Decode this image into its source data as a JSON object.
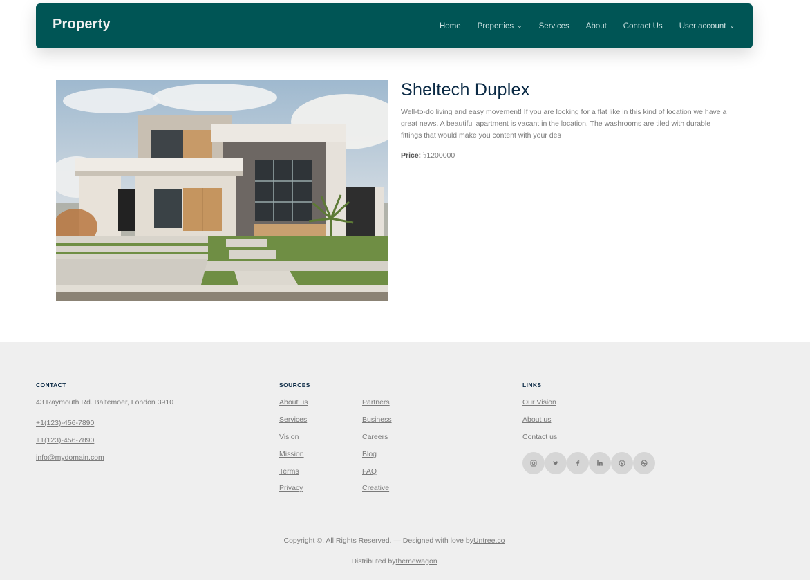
{
  "nav": {
    "brand": "Property",
    "items": [
      {
        "label": "Home",
        "dropdown": false
      },
      {
        "label": "Properties",
        "dropdown": true
      },
      {
        "label": "Services",
        "dropdown": false
      },
      {
        "label": "About",
        "dropdown": false
      },
      {
        "label": "Contact Us",
        "dropdown": false
      },
      {
        "label": "User account",
        "dropdown": true
      }
    ]
  },
  "property": {
    "title": "Sheltech Duplex",
    "description": "Well-to-do living and easy movement! If you are looking for a flat like in this kind of location we have a great news. A beautiful apartment is vacant in the location. The washrooms are tiled with durable fittings that would make you content with your des",
    "price_label": "Price:",
    "price_value": "৳1200000"
  },
  "footer": {
    "contact": {
      "heading": "CONTACT",
      "address": "43 Raymouth Rd. Baltemoer, London 3910",
      "phone1": "+1(123)-456-7890",
      "phone2": "+1(123)-456-7890",
      "email": "info@mydomain.com"
    },
    "sources": {
      "heading": "SOURCES",
      "col1": [
        "About us",
        "Services",
        "Vision",
        "Mission",
        "Terms",
        "Privacy"
      ],
      "col2": [
        "Partners",
        "Business",
        "Careers",
        "Blog",
        "FAQ",
        "Creative"
      ]
    },
    "links": {
      "heading": "LINKS",
      "items": [
        "Our Vision",
        "About us",
        "Contact us"
      ]
    },
    "socials": [
      "instagram-icon",
      "twitter-icon",
      "facebook-icon",
      "linkedin-icon",
      "pinterest-icon",
      "dribbble-icon"
    ],
    "copyright": "Copyright ©. All Rights Reserved. — Designed with love by",
    "copyright_link": "Untree.co",
    "distributed": "Distributed by",
    "distributed_link": "themewagon"
  },
  "colors": {
    "nav_bg": "#005555",
    "title": "#0b2a45",
    "footer_bg": "#efefef"
  }
}
